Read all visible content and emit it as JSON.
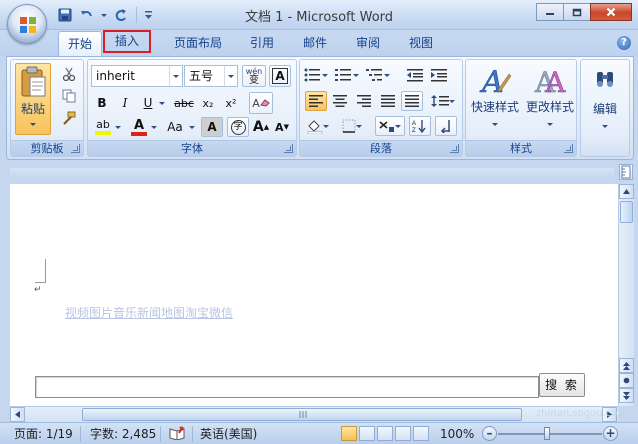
{
  "window": {
    "title": "文档 1 - Microsoft Word"
  },
  "tabs": [
    {
      "label": "开始",
      "active": true
    },
    {
      "label": "插入",
      "highlighted": true
    },
    {
      "label": "页面布局"
    },
    {
      "label": "引用"
    },
    {
      "label": "邮件"
    },
    {
      "label": "审阅"
    },
    {
      "label": "视图"
    }
  ],
  "ribbon": {
    "clipboard": {
      "label": "剪贴板",
      "paste": "粘贴"
    },
    "font": {
      "label": "字体",
      "font_name": "inherit",
      "font_size": "五号",
      "wen_glyph": "wén",
      "wen_char": "变",
      "border_a": "A",
      "bold": "B",
      "italic": "I",
      "underline": "U",
      "strike": "abc",
      "subscript": "x₂",
      "superscript": "x²",
      "clear_format": "A",
      "highlight": "ab",
      "font_color": "A",
      "change_case": "Aa",
      "shading_a": "A",
      "circle_char": "字",
      "grow": "A",
      "shrink": "A"
    },
    "paragraph": {
      "label": "段落"
    },
    "styles": {
      "label": "样式",
      "quick_styles": "快速样式",
      "change_styles": "更改样式"
    },
    "editing": {
      "label": "编辑"
    }
  },
  "document": {
    "link_text": "视频图片音乐新闻地图淘宝微信",
    "search_button": "搜 索",
    "search_value": ""
  },
  "statusbar": {
    "page": "页面: 1/19",
    "words": "字数: 2,485",
    "language": "英语(美国)",
    "zoom": "100%"
  },
  "watermark": "zhinan.sogou.com",
  "colors": {
    "accent": "#15428b",
    "highlight_red": "#d3212b",
    "font_color_bar": "#e0201b",
    "highlight_bar": "#f5f500"
  }
}
